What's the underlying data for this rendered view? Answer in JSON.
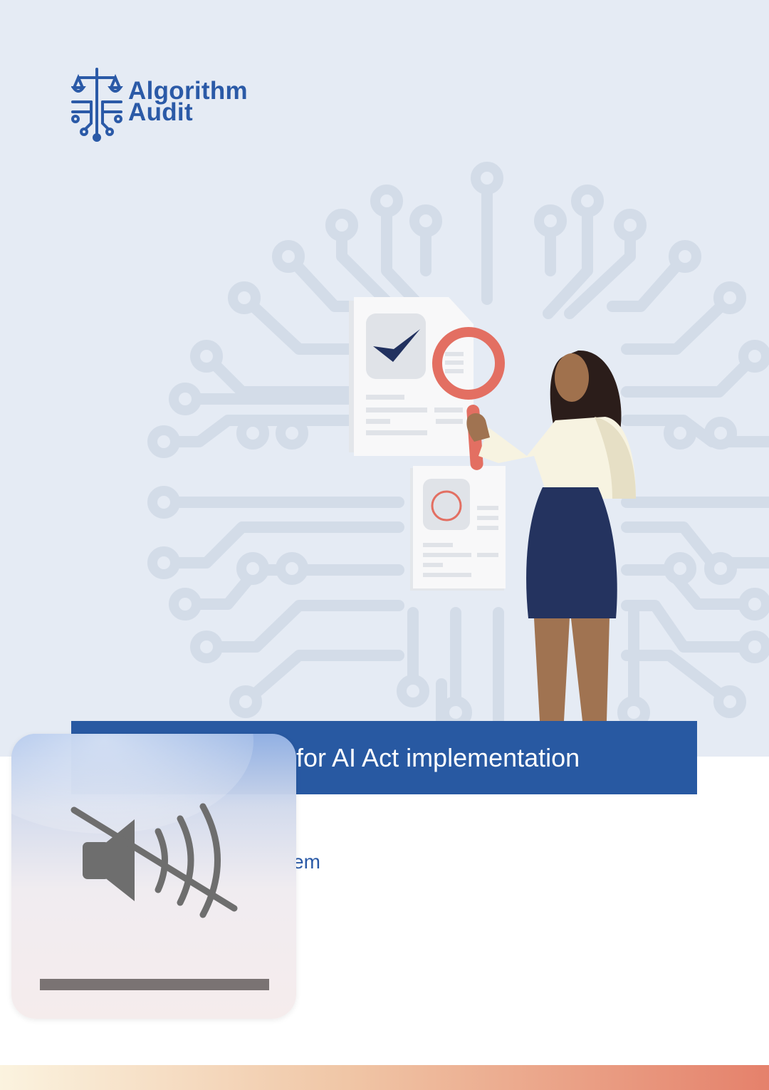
{
  "brand": {
    "logo_line1": "Algorithm",
    "logo_line2": "Audit",
    "logo_icon": "scales-circuit-icon",
    "color": "#2b5aa7"
  },
  "cover": {
    "title_visible": "for AI Act implementation",
    "subtitle_visible": "em",
    "title_bar_color": "#2859a2",
    "hero_background": "#e5ebf4"
  },
  "illustration": {
    "description_icons": [
      "circuit-board-pattern",
      "document-check-icon",
      "magnifying-glass-icon",
      "document-refresh-icon",
      "auditor-person"
    ]
  },
  "overlay": {
    "type": "volume-hud",
    "icon": "speaker-muted-icon",
    "volume_level": 0,
    "bar_color": "#7a7373"
  },
  "colors": {
    "accent_blue": "#2859a2",
    "accent_coral": "#e5816b"
  }
}
